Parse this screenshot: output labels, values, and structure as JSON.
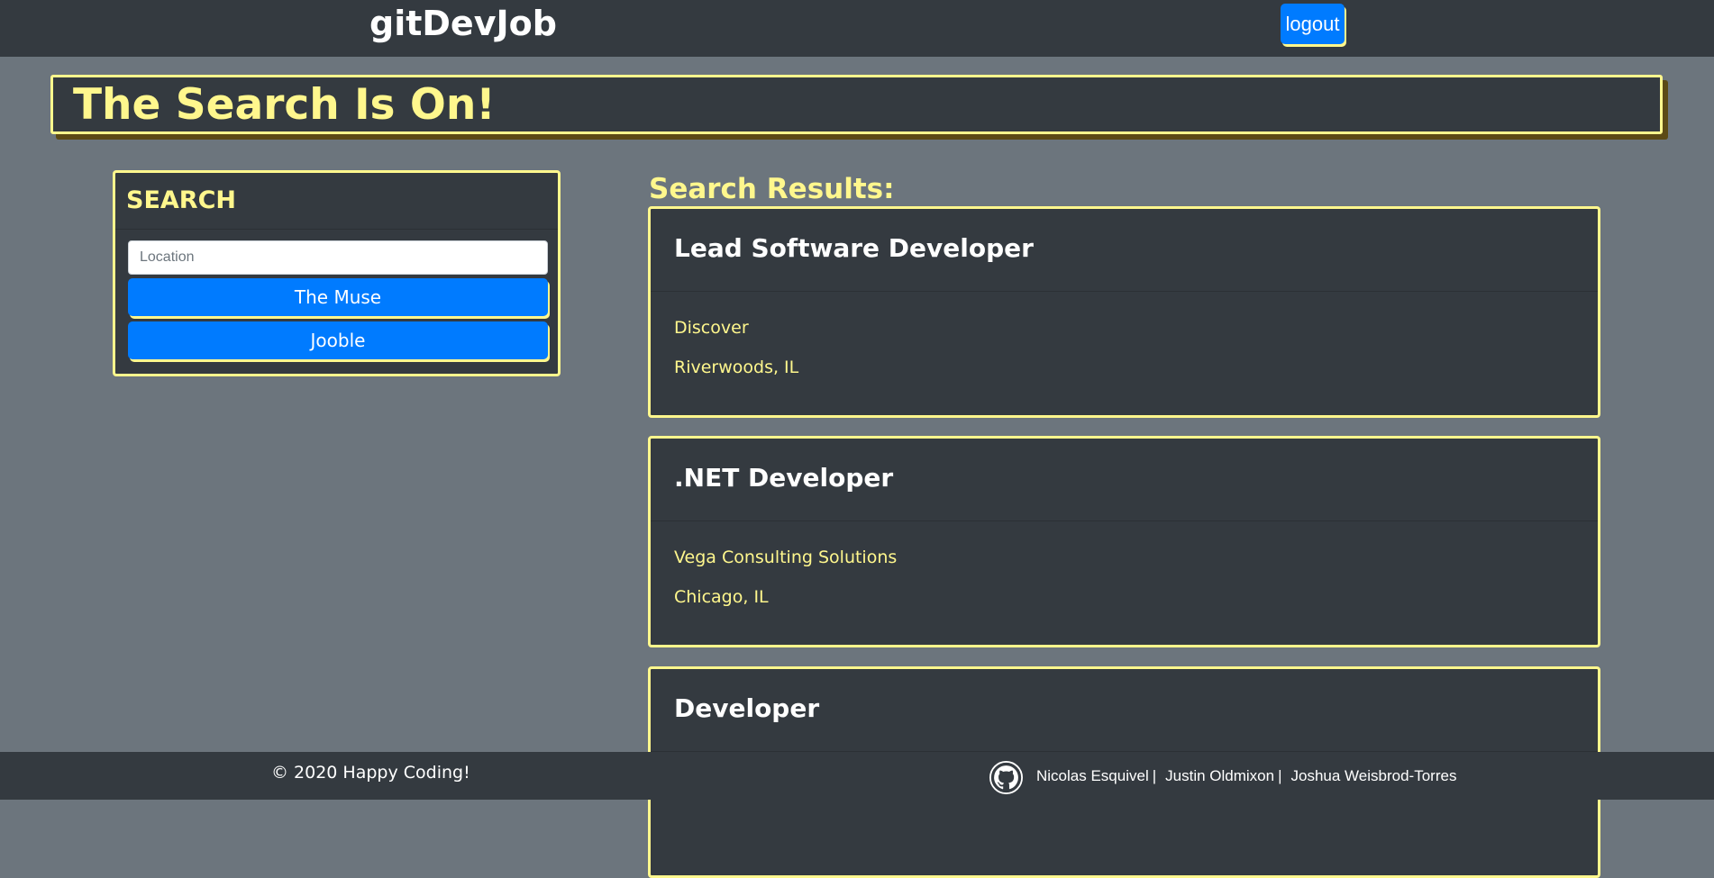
{
  "navbar": {
    "brand": "gitDevJob",
    "logout_label": "logout"
  },
  "jumbotron": {
    "title": "The Search Is On!"
  },
  "search": {
    "title": "SEARCH",
    "location_placeholder": "Location",
    "location_value": "",
    "buttons": [
      "The Muse",
      "Jooble"
    ]
  },
  "results": {
    "heading": "Search Results:",
    "items": [
      {
        "title": "Lead Software Developer",
        "company": "Discover",
        "location": "Riverwoods, IL"
      },
      {
        "title": ".NET Developer",
        "company": "Vega Consulting Solutions",
        "location": "Chicago, IL"
      },
      {
        "title": "Developer",
        "company": "",
        "location": ""
      }
    ]
  },
  "footer": {
    "copyright": "© 2020 Happy Coding!",
    "authors": [
      "Nicolas Esquivel",
      "Justin Oldmixon",
      "Joshua Weisbrod-Torres"
    ],
    "separator": "|",
    "icon": "github-icon"
  },
  "colors": {
    "navbar_bg": "#343a40",
    "page_bg": "#6c757d",
    "accent_yellow": "#fff78d",
    "button_blue": "#007bff"
  }
}
